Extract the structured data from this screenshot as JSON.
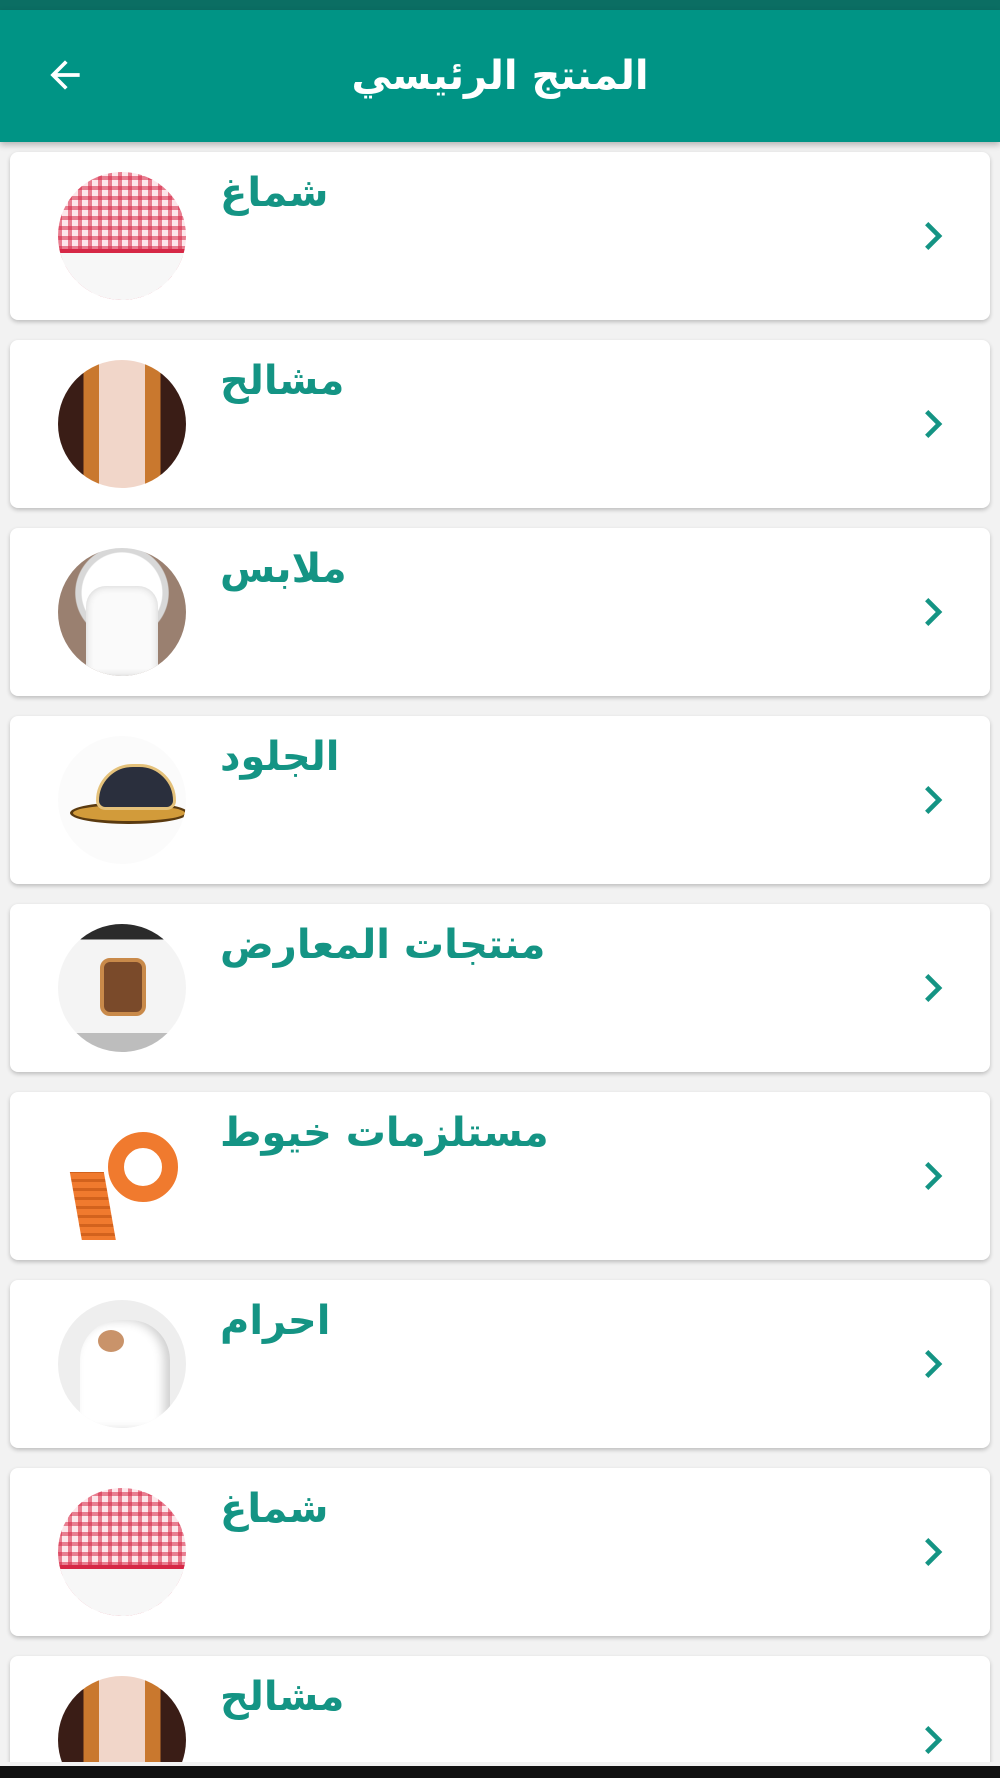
{
  "app_bar": {
    "title": "المنتج الرئيسي",
    "back_icon": "arrow-left-icon",
    "color": "#009485"
  },
  "items": [
    {
      "label": "شماغ",
      "image": "shemagh-image"
    },
    {
      "label": "مشالح",
      "image": "bisht-image"
    },
    {
      "label": "ملابس",
      "image": "tshirt-image"
    },
    {
      "label": "الجلود",
      "image": "sandal-image"
    },
    {
      "label": "منتجات المعارض",
      "image": "watch-set-image"
    },
    {
      "label": "مستلزمات خيوط",
      "image": "belt-roll-image"
    },
    {
      "label": "احرام",
      "image": "ihram-image"
    },
    {
      "label": "شماغ",
      "image": "shemagh-image"
    },
    {
      "label": "مشالح",
      "image": "bisht-image"
    }
  ],
  "accent_color": "#149484",
  "chevron_icon": "chevron-right-icon"
}
